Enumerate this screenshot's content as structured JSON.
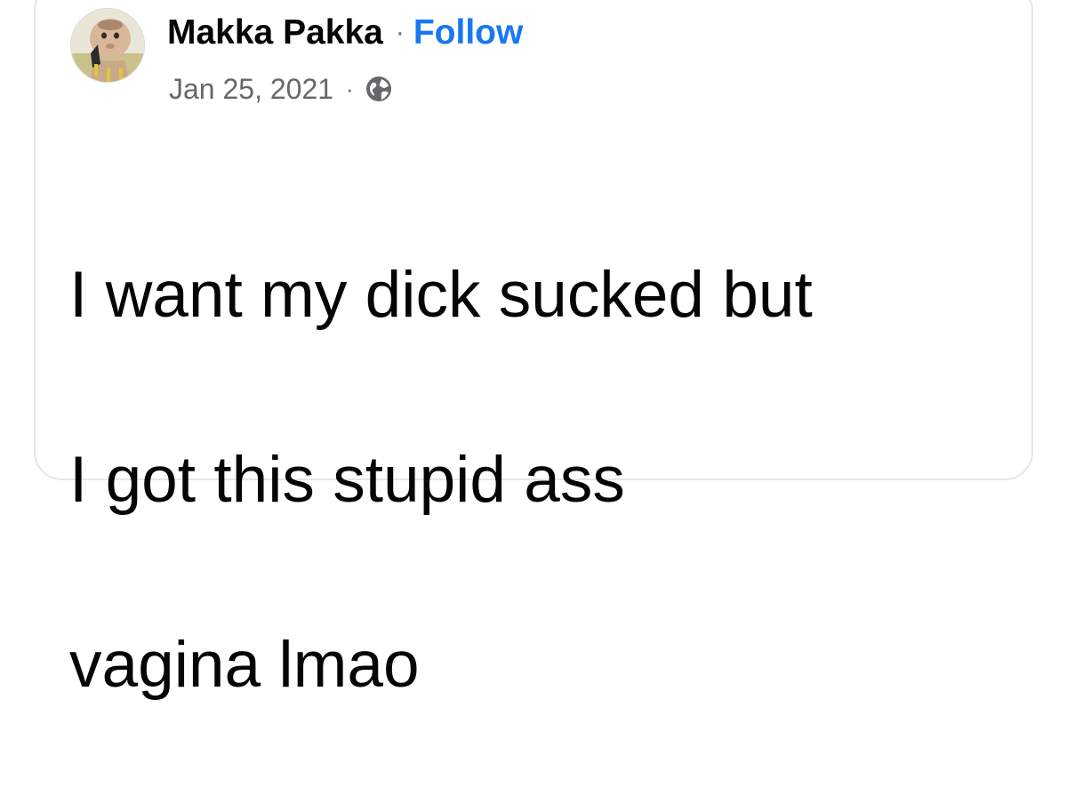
{
  "post": {
    "author": {
      "name": "Makka Pakka",
      "separator": "·",
      "follow_label": "Follow"
    },
    "meta": {
      "date": "Jan 25, 2021",
      "separator": "·",
      "audience_icon": "globe-icon"
    },
    "body_lines": [
      "I want my dick sucked but",
      "I got this stupid ass",
      "vagina lmao"
    ]
  },
  "colors": {
    "follow_link": "#1877f2",
    "primary_text": "#050505",
    "secondary_text": "#65676b",
    "card_border": "#e6e7ea"
  }
}
